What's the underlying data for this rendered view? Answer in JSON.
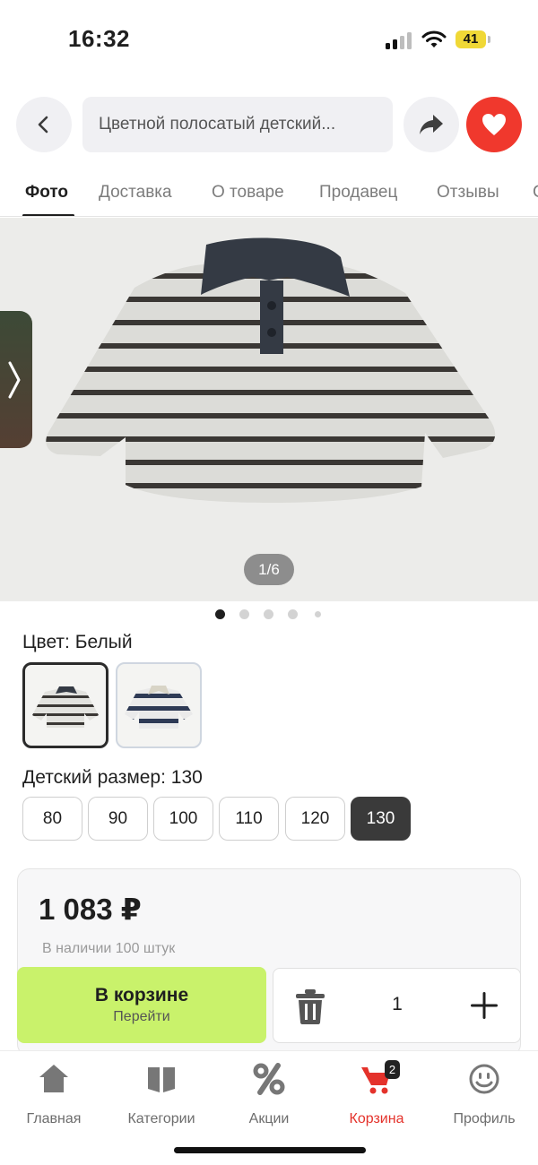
{
  "status_bar": {
    "time": "16:32",
    "battery": "41",
    "icons": [
      "signal-icon",
      "wifi-icon",
      "battery-icon"
    ]
  },
  "header": {
    "search_text": "Цветной полосатый детский...",
    "icons": [
      "back-icon",
      "share-icon",
      "heart-icon"
    ],
    "favorite_color": "#f0382d"
  },
  "tabs": [
    "Фото",
    "Доставка",
    "О товаре",
    "Продавец",
    "Отзывы"
  ],
  "active_tab": "Фото",
  "gallery": {
    "counter": "1/6",
    "dots_count": 5,
    "active_dot": 1
  },
  "color": {
    "label": "Цвет: Белый",
    "options": [
      "white-striped",
      "navy-striped"
    ],
    "selected": "white-striped"
  },
  "size": {
    "label": "Детский размер: 130",
    "options": [
      "80",
      "90",
      "100",
      "110",
      "120",
      "130"
    ],
    "selected": "130"
  },
  "purchase": {
    "price": "1 083 ₽",
    "stock": "В наличии 100 штук",
    "cart_button_title": "В корзине",
    "cart_button_sub": "Перейти",
    "cart_button_color": "#c9f26b",
    "quantity": "1"
  },
  "bottom_nav": {
    "items": [
      {
        "label": "Главная",
        "icon": "home-icon"
      },
      {
        "label": "Категории",
        "icon": "book-icon"
      },
      {
        "label": "Акции",
        "icon": "percent-icon"
      },
      {
        "label": "Корзина",
        "icon": "cart-icon"
      },
      {
        "label": "Профиль",
        "icon": "smiley-icon"
      }
    ],
    "active": "Корзина",
    "cart_badge": "2",
    "active_color": "#e4322b"
  }
}
